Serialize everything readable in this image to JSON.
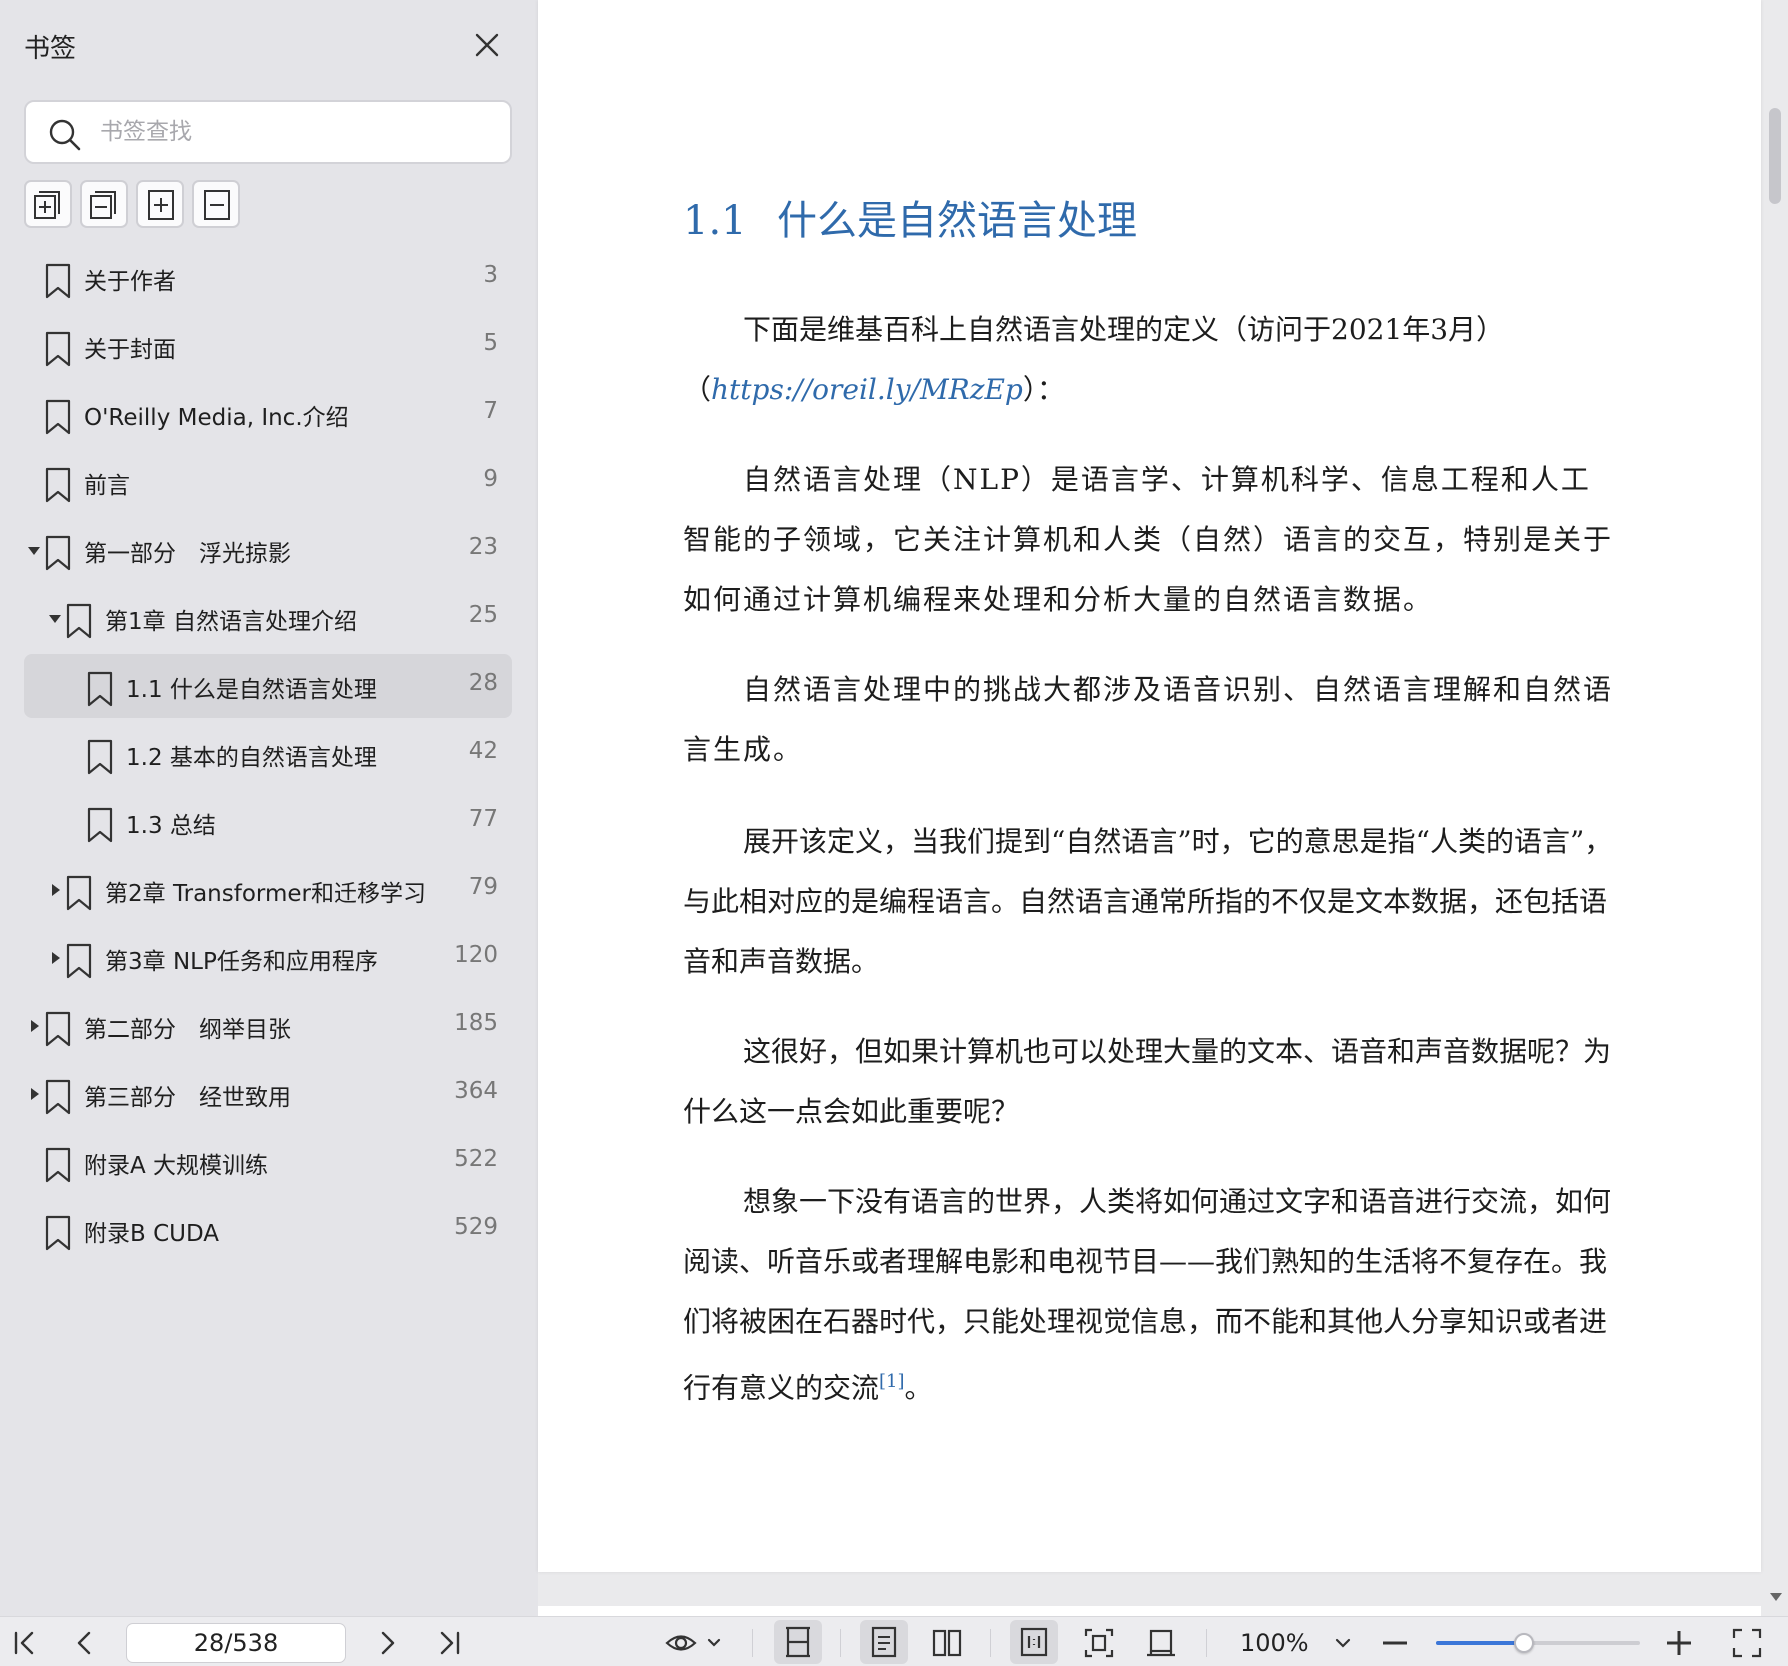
{
  "sidebar": {
    "title": "书签",
    "search_placeholder": "书签查找",
    "toolbar": [
      "expand-all",
      "collapse-all",
      "add-bookmark",
      "delete-bookmark"
    ],
    "items": [
      {
        "label": "关于作者",
        "page": "3",
        "level": 0,
        "arrow": "none",
        "selected": false
      },
      {
        "label": "关于封面",
        "page": "5",
        "level": 0,
        "arrow": "none",
        "selected": false
      },
      {
        "label": "O'Reilly Media, Inc.介绍",
        "page": "7",
        "level": 0,
        "arrow": "none",
        "selected": false
      },
      {
        "label": "前言",
        "page": "9",
        "level": 0,
        "arrow": "none",
        "selected": false
      },
      {
        "label": "第一部分　浮光掠影",
        "page": "23",
        "level": 0,
        "arrow": "down",
        "selected": false
      },
      {
        "label": "第1章 自然语言处理介绍",
        "page": "25",
        "level": 1,
        "arrow": "down",
        "selected": false
      },
      {
        "label": "1.1 什么是自然语言处理",
        "page": "28",
        "level": 2,
        "arrow": "none",
        "selected": true
      },
      {
        "label": "1.2 基本的自然语言处理",
        "page": "42",
        "level": 2,
        "arrow": "none",
        "selected": false
      },
      {
        "label": "1.3 总结",
        "page": "77",
        "level": 2,
        "arrow": "none",
        "selected": false
      },
      {
        "label": "第2章 Transformer和迁移学习",
        "page": "79",
        "level": 1,
        "arrow": "right",
        "selected": false
      },
      {
        "label": "第3章 NLP任务和应用程序",
        "page": "120",
        "level": 1,
        "arrow": "right",
        "selected": false
      },
      {
        "label": "第二部分　纲举目张",
        "page": "185",
        "level": 0,
        "arrow": "right",
        "selected": false
      },
      {
        "label": "第三部分　经世致用",
        "page": "364",
        "level": 0,
        "arrow": "right",
        "selected": false
      },
      {
        "label": "附录A 大规模训练",
        "page": "522",
        "level": 0,
        "arrow": "none",
        "selected": false
      },
      {
        "label": "附录B CUDA",
        "page": "529",
        "level": 0,
        "arrow": "none",
        "selected": false
      }
    ]
  },
  "document": {
    "heading_number": "1.1",
    "heading_title": "什么是自然语言处理",
    "para1_text": "下面是维基百科上自然语言处理的定义（访问于2021年3月）",
    "para1_link_open": "（",
    "para1_link": "https://oreil.ly/MRzEp",
    "para1_link_close": "）：",
    "para2": "自然语言处理（NLP）是语言学、计算机科学、信息工程和人工智能的子领域，它关注计算机和人类（自然）语言的交互，特别是关于如何通过计算机编程来处理和分析大量的自然语言数据。",
    "para3": "自然语言处理中的挑战大都涉及语音识别、自然语言理解和自然语言生成。",
    "para4": "展开该定义，当我们提到“自然语言”时，它的意思是指“人类的语言”，与此相对应的是编程语言。自然语言通常所指的不仅是文本数据，还包括语音和声音数据。",
    "para5": "这很好，但如果计算机也可以处理大量的文本、语音和声音数据呢？为什么这一点会如此重要呢？",
    "para6_text": "想象一下没有语言的世界，人类将如何通过文字和语音进行交流，如何阅读、听音乐或者理解电影和电视节目——我们熟知的生活将不复存在。我们将被困在石器时代，只能处理视觉信息，而不能和其他人分享知识或者进行有意义的交流",
    "para6_footnote": "[1]",
    "para6_end": "。"
  },
  "bottombar": {
    "page_value": "28/538",
    "zoom_label": "100%",
    "zoom_fraction": 0.43,
    "accent_color": "#3b76d8"
  },
  "colors": {
    "heading": "#2f6aab",
    "link": "#2f6aab",
    "selected_row": "#d6d6da"
  }
}
